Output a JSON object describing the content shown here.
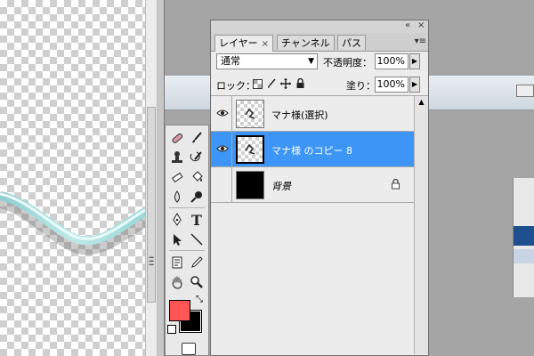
{
  "panel": {
    "tabs": [
      {
        "label": "レイヤー",
        "close": "×"
      },
      {
        "label": "チャンネル"
      },
      {
        "label": "パス"
      }
    ],
    "menu_glyph": "▾≡",
    "collapse_glyph": "«",
    "close_glyph": "×"
  },
  "blend": {
    "mode": "通常",
    "opacity_label": "不透明度：",
    "opacity_value": "100%"
  },
  "lock": {
    "label": "ロック：",
    "fill_label": "塗り：",
    "fill_value": "100%"
  },
  "layers": [
    {
      "name": "マナ様(選択)",
      "visible": true,
      "selected": false,
      "thumb": "transparent"
    },
    {
      "name": "マナ様 のコピー 8",
      "visible": true,
      "selected": true,
      "thumb": "transparent"
    },
    {
      "name": "背景",
      "visible": false,
      "selected": false,
      "thumb": "black",
      "locked": true
    }
  ],
  "toolbox": {
    "foreground_color": "#ff5555",
    "background_color": "#000000",
    "type_tool_glyph": "T"
  },
  "colors": {
    "selection": "#3d96f5"
  }
}
